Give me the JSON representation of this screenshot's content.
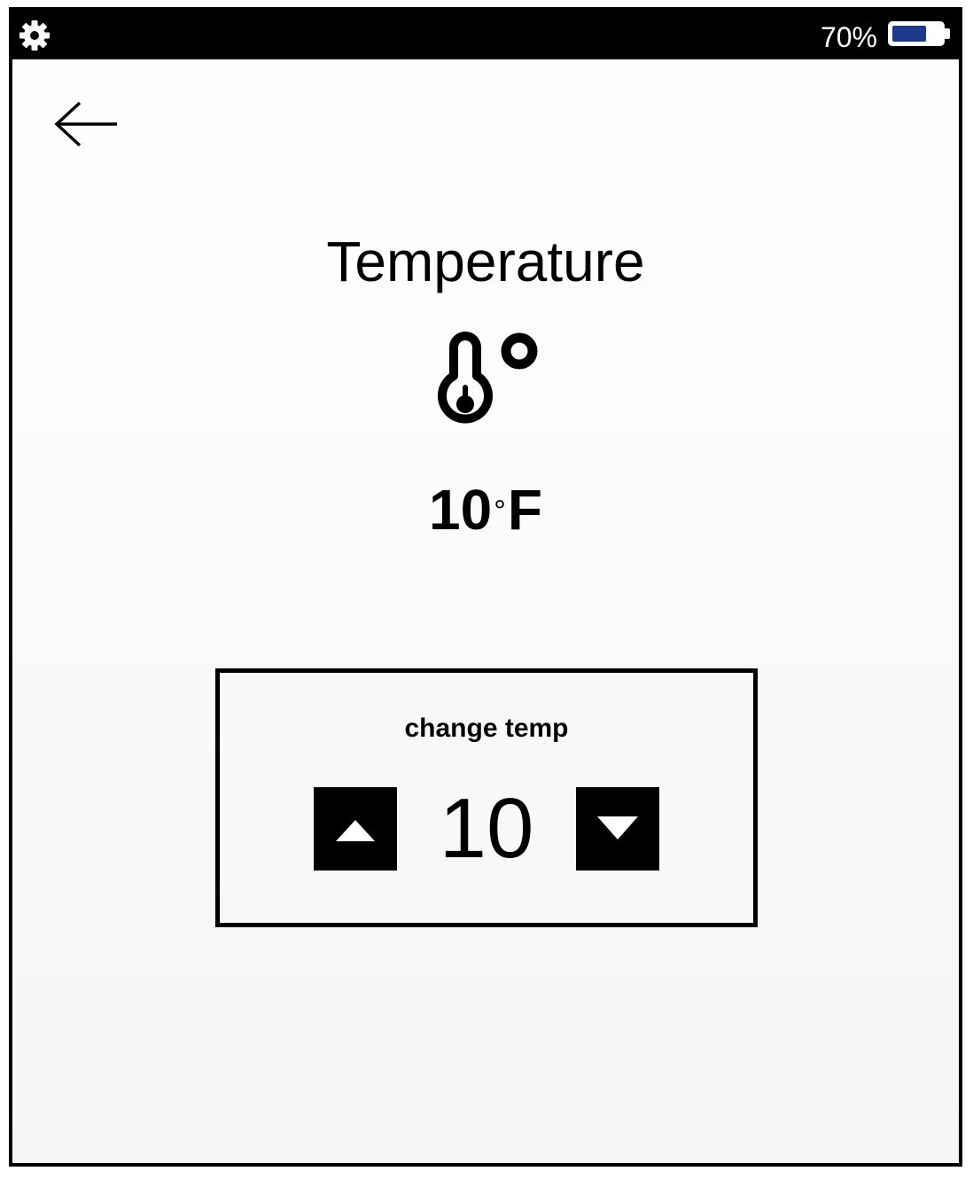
{
  "status_bar": {
    "settings_icon": "gear-icon",
    "battery_percent_text": "70%",
    "battery_level": 0.7,
    "battery_fill_color": "#1e3a8a"
  },
  "nav": {
    "back_icon": "arrow-left-icon"
  },
  "main": {
    "title": "Temperature",
    "icon": "thermometer-icon",
    "current_temp": {
      "value": "10",
      "degree_symbol": "°",
      "unit": "F"
    }
  },
  "temp_control": {
    "label": "change temp",
    "value": "10",
    "increase_icon": "triangle-up-icon",
    "decrease_icon": "triangle-down-icon"
  }
}
